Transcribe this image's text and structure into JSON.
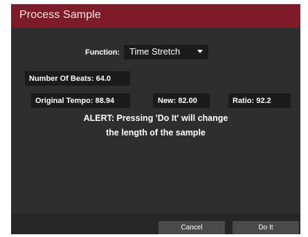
{
  "dialog": {
    "title": "Process Sample"
  },
  "function": {
    "label": "Function:",
    "value": "Time Stretch"
  },
  "beats": {
    "label": "Number Of Beats:",
    "value": "64.0"
  },
  "original_tempo": {
    "label": "Original Tempo:",
    "value": "88.94"
  },
  "new_tempo": {
    "label": "New:",
    "value": "82.00"
  },
  "ratio": {
    "label": "Ratio:",
    "value": "92.2"
  },
  "alert": {
    "line1": "ALERT: Pressing 'Do It' will change",
    "line2": "the length of the sample"
  },
  "buttons": {
    "cancel": "Cancel",
    "do_it": "Do It"
  },
  "colors": {
    "title_bar": "#7d1c28",
    "panel": "#2e2e2e",
    "field": "#1b1b1b",
    "button": "#4a4a4a"
  }
}
